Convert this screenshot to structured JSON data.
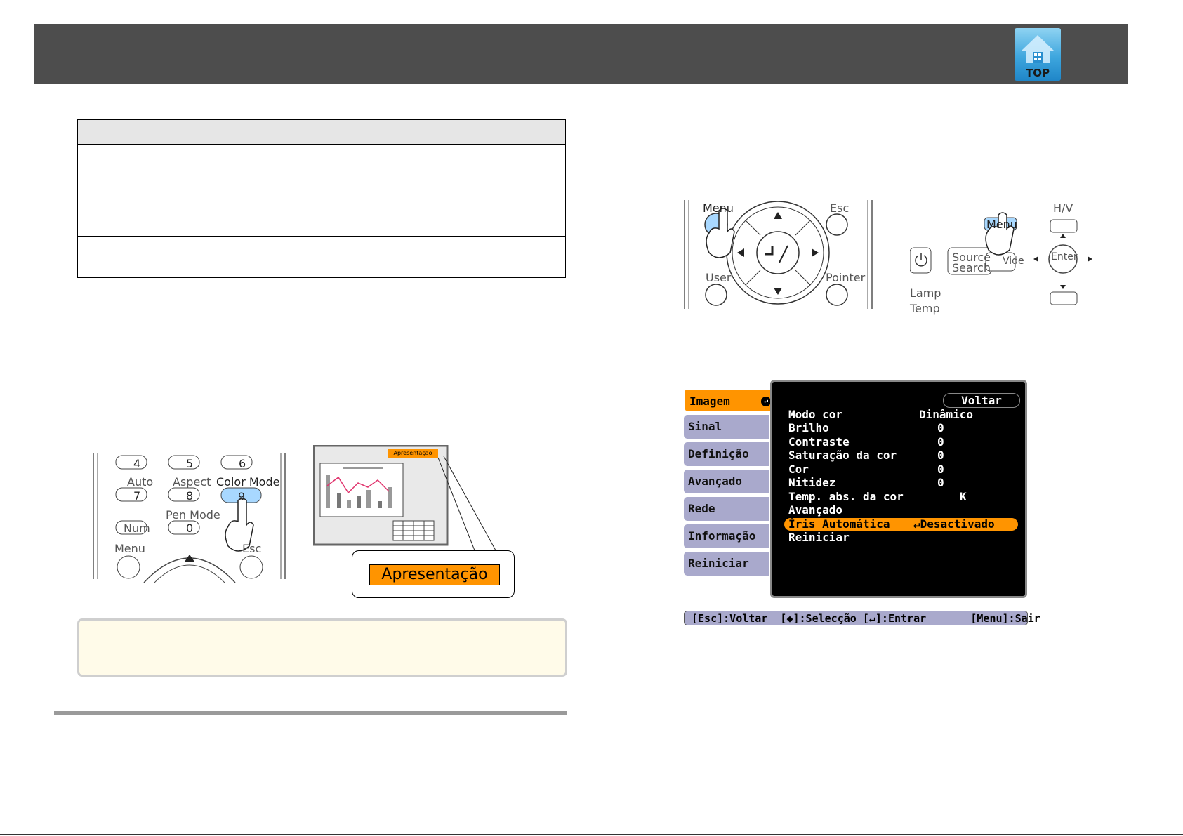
{
  "header": {
    "top_button_label": "TOP"
  },
  "remote_color_mode": {
    "keys_row1": [
      "4",
      "5",
      "6"
    ],
    "labels_row2": [
      "Auto",
      "Aspect",
      "Color Mode"
    ],
    "keys_row2": [
      "7",
      "8",
      "9"
    ],
    "pen_mode_label": "Pen Mode",
    "num_label": "Num",
    "key_zero": "0",
    "menu_label": "Menu",
    "esc_label": "Esc"
  },
  "projection_preview": {
    "badge_small": "Apresentação",
    "callout_label": "Apresentação"
  },
  "remote_menu": {
    "menu_label": "Menu",
    "esc_label": "Esc",
    "user_label": "User",
    "pointer_label": "Pointer"
  },
  "control_panel": {
    "hv_label": "H/V",
    "menu_label": "Menu",
    "source_label": "Source",
    "search_label": "Search",
    "wide_label": "Vide",
    "enter_label": "Enter",
    "lamp_label": "Lamp",
    "temp_label": "Temp"
  },
  "osd_menu": {
    "tabs": [
      {
        "label": "Imagem",
        "active": true
      },
      {
        "label": "Sinal"
      },
      {
        "label": "Definição"
      },
      {
        "label": "Avançado"
      },
      {
        "label": "Rede"
      },
      {
        "label": "Informação"
      },
      {
        "label": "Reiniciar"
      }
    ],
    "back_label": "Voltar",
    "rows": [
      {
        "label": "Modo cor",
        "value": "Dinâmico"
      },
      {
        "label": "Brilho",
        "value": "0"
      },
      {
        "label": "Contraste",
        "value": "0"
      },
      {
        "label": "Saturação da cor",
        "value": "0"
      },
      {
        "label": "Cor",
        "value": "0"
      },
      {
        "label": "Nitidez",
        "value": "0"
      },
      {
        "label": "Temp. abs. da cor",
        "value": "K"
      },
      {
        "label": "Avançado",
        "value": ""
      },
      {
        "label": "Íris Automática",
        "value": "↵Desactivado",
        "active": true
      },
      {
        "label": "Reiniciar",
        "value": ""
      }
    ],
    "footer": "[Esc]:Voltar  [◆]:Selecção [↵]:Entrar       [Menu]:Sair"
  },
  "colors": {
    "header_bg": "#4d4d4d",
    "accent_orange": "#ff9400",
    "osd_tab": "#a9a9cc",
    "note_bg": "#fffbe9"
  }
}
